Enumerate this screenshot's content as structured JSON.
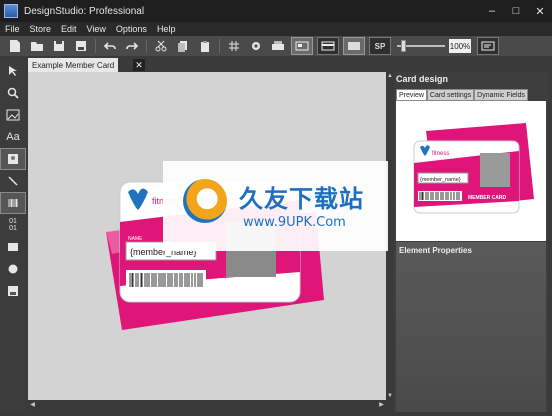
{
  "window": {
    "title": "DesignStudio: Professional",
    "controls": {
      "minimize": "–",
      "maximize": "□",
      "close": "✕"
    }
  },
  "menu": [
    "File",
    "Store",
    "Edit",
    "View",
    "Options",
    "Help"
  ],
  "toolbar": {
    "buttons": [
      "new-document-icon",
      "open-folder-icon",
      "save-icon",
      "save-all-icon",
      "undo-icon",
      "redo-icon",
      "cut-icon",
      "copy-icon",
      "paste-icon",
      "grid-icon",
      "settings-gear-icon",
      "print-icon",
      "card-front-icon",
      "card-back-icon",
      "blank-card-icon",
      "sp-icon"
    ],
    "sp_label": "SP",
    "zoom_level": 0.1,
    "zoom_text": "100%"
  },
  "left_tools": {
    "text_tool_label": "Aa",
    "barcode_tool_label": "01\n01"
  },
  "document": {
    "tab_label": "Example Member Card",
    "tab_close": "✕"
  },
  "card": {
    "name_label": "NAME",
    "member_field": "{member_name}",
    "member_card_label": "MEMBER CARD",
    "brand": "fitness",
    "colors": {
      "magenta": "#e0157a",
      "light_pink": "#f5a7c9",
      "blue": "#1f74c2"
    }
  },
  "right_panel": {
    "title": "Card design",
    "tabs": [
      "Preview",
      "Card settings",
      "Dynamic Fields"
    ],
    "active_tab": "Preview",
    "element_properties_title": "Element Properties"
  },
  "watermark": {
    "chinese_text": "久友下载站",
    "url": "www.9UPK.Com"
  }
}
